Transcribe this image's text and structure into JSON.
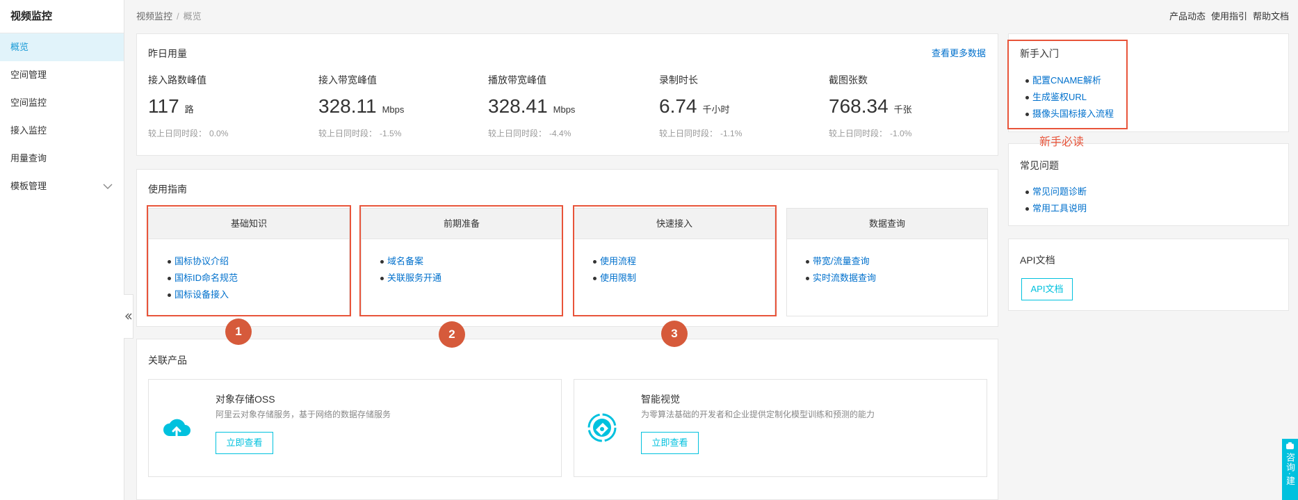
{
  "sidebar": {
    "title": "视频监控",
    "items": [
      {
        "label": "概览",
        "active": true
      },
      {
        "label": "空间管理"
      },
      {
        "label": "空间监控"
      },
      {
        "label": "接入监控"
      },
      {
        "label": "用量查询"
      },
      {
        "label": "模板管理",
        "icon": "chevron-down-icon"
      }
    ],
    "collapse_icon": "double-chevron-left-icon"
  },
  "breadcrumb": {
    "items": [
      "视频监控",
      "概览"
    ],
    "separator": "/"
  },
  "top_links": [
    "产品动态",
    "使用指引",
    "帮助文档"
  ],
  "usage": {
    "title": "昨日用量",
    "more_link": "查看更多数据",
    "compare_label": "较上日同时段：",
    "metrics": [
      {
        "label": "接入路数峰值",
        "value": "117",
        "unit": "路",
        "change": "0.0%"
      },
      {
        "label": "接入带宽峰值",
        "value": "328.11",
        "unit": "Mbps",
        "change": "-1.5%"
      },
      {
        "label": "播放带宽峰值",
        "value": "328.41",
        "unit": "Mbps",
        "change": "-4.4%"
      },
      {
        "label": "录制时长",
        "value": "6.74",
        "unit": "千小时",
        "change": "-1.1%"
      },
      {
        "label": "截图张数",
        "value": "768.34",
        "unit": "千张",
        "change": "-1.0%"
      }
    ]
  },
  "guide": {
    "title": "使用指南",
    "cards": [
      {
        "title": "基础知识",
        "links": [
          "国标协议介绍",
          "国标ID命名规范",
          "国标设备接入"
        ]
      },
      {
        "title": "前期准备",
        "links": [
          "域名备案",
          "关联服务开通"
        ]
      },
      {
        "title": "快速接入",
        "links": [
          "使用流程",
          "使用限制"
        ]
      },
      {
        "title": "数据查询",
        "links": [
          "带宽/流量查询",
          "实时流数据查询"
        ]
      }
    ]
  },
  "products": {
    "title": "关联产品",
    "items": [
      {
        "name": "对象存储OSS",
        "desc": "阿里云对象存储服务，基于网络的数据存储服务",
        "button": "立即查看",
        "icon": "cloud-upload-icon"
      },
      {
        "name": "智能视觉",
        "desc": "为零算法基础的开发者和企业提供定制化模型训练和预测的能力",
        "button": "立即查看",
        "icon": "vision-icon"
      }
    ]
  },
  "beginner": {
    "title": "新手入门",
    "links": [
      "配置CNAME解析",
      "生成鉴权URL",
      "摄像头国标接入流程"
    ]
  },
  "faq": {
    "title": "常见问题",
    "links": [
      "常见问题诊断",
      "常用工具说明"
    ]
  },
  "api": {
    "title": "API文档",
    "button": "API文档"
  },
  "annotations": {
    "markers": [
      "1",
      "2",
      "3"
    ],
    "note": "新手必读"
  },
  "consult": {
    "label": "咨询·建",
    "icon": "consult-icon"
  },
  "colors": {
    "accent": "#00c1de",
    "link": "#0070cc",
    "active_item_bg": "#e1f3fa",
    "annotation": "#e8543a",
    "marker": "#d65a3b"
  }
}
